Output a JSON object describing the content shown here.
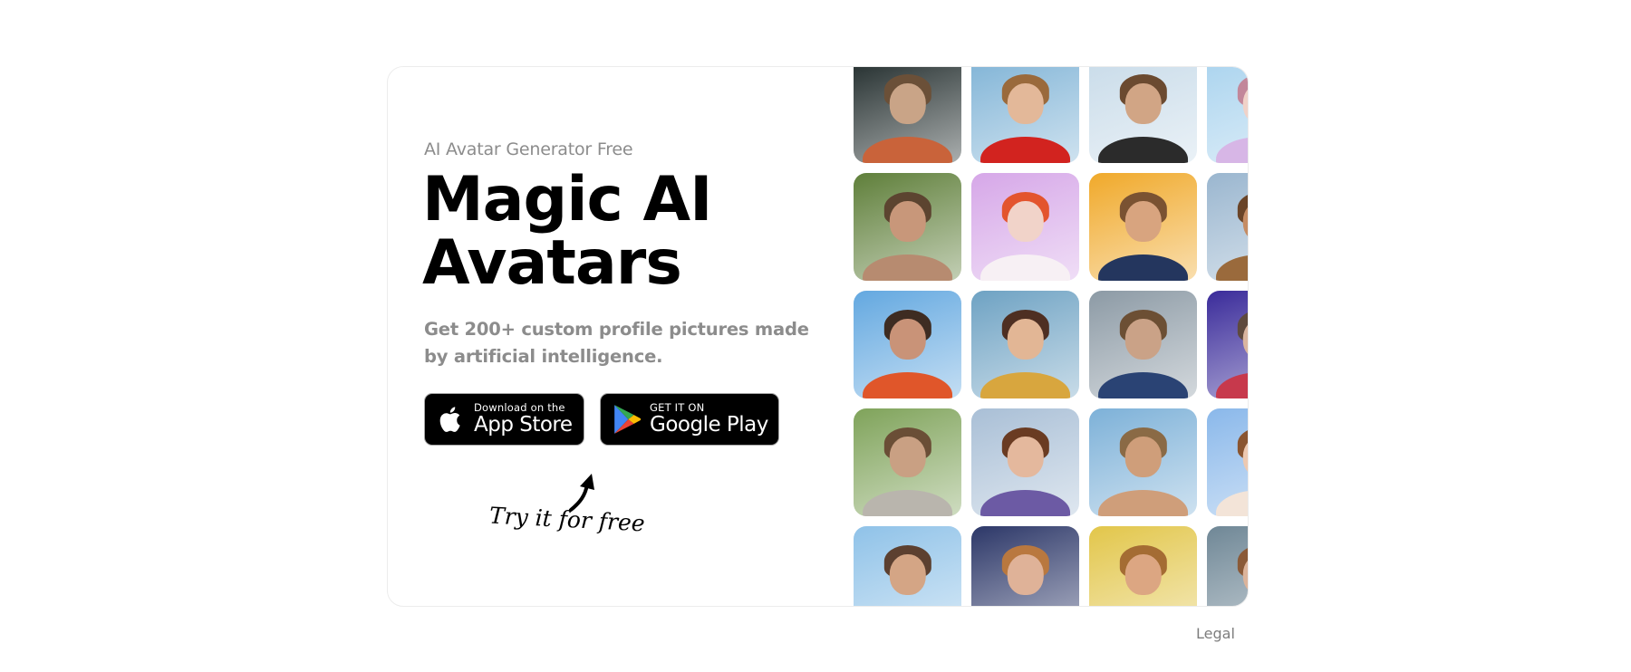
{
  "hero": {
    "subtitle": "AI Avatar Generator Free",
    "title_line1": "Magic AI",
    "title_line2": "Avatars",
    "description": "Get 200+ custom profile pictures made by artificial intelligence."
  },
  "buttons": {
    "app_store": {
      "small": "Download on the",
      "big": "App Store",
      "icon": "apple-icon"
    },
    "google_play": {
      "small": "GET IT ON",
      "big": "Google Play",
      "icon": "google-play-icon"
    }
  },
  "callout": {
    "text": "Try it for free",
    "icon": "curved-arrow-icon"
  },
  "footer": {
    "legal": "Legal"
  },
  "colors": {
    "text_muted": "#8c8c8c",
    "button_bg": "#000000",
    "card_border": "#ececec"
  },
  "avatars": [
    {
      "bg": "#1f2a2a",
      "skin": "#c9a487",
      "hair": "#6b5038",
      "cloth": "#c9633a"
    },
    {
      "bg": "#7fb3d6",
      "skin": "#e3b899",
      "hair": "#9a6a3c",
      "cloth": "#d2231f"
    },
    {
      "bg": "#c8dbe9",
      "skin": "#d1a585",
      "hair": "#6b4a30",
      "cloth": "#2b2b2b"
    },
    {
      "bg": "#a9d3ee",
      "skin": "#f0d2c8",
      "hair": "#c2879a",
      "cloth": "#d7b6e6"
    },
    {
      "bg": "#5f7f3a",
      "skin": "#c8977a",
      "hair": "#5c4430",
      "cloth": "#b78b70"
    },
    {
      "bg": "#d6a7e8",
      "skin": "#f1d3c9",
      "hair": "#e3542e",
      "cloth": "#f7f0f4"
    },
    {
      "bg": "#f0a92a",
      "skin": "#d8a47f",
      "hair": "#7a5232",
      "cloth": "#24365e"
    },
    {
      "bg": "#9ab6cf",
      "skin": "#c58c64",
      "hair": "#6a4428",
      "cloth": "#9a6a3c"
    },
    {
      "bg": "#63a8e0",
      "skin": "#c99378",
      "hair": "#3e2c22",
      "cloth": "#e0562a"
    },
    {
      "bg": "#6ea2c3",
      "skin": "#e2b695",
      "hair": "#4e2f22",
      "cloth": "#d8a63e"
    },
    {
      "bg": "#8c9aa5",
      "skin": "#caa287",
      "hair": "#6c4f34",
      "cloth": "#2a4374"
    },
    {
      "bg": "#3a2b9a",
      "skin": "#d9b5a0",
      "hair": "#5e4a3e",
      "cloth": "#c7394c"
    },
    {
      "bg": "#7fa35a",
      "skin": "#c9a083",
      "hair": "#6a4e36",
      "cloth": "#b9b5ad"
    },
    {
      "bg": "#a9bfd6",
      "skin": "#e4b89d",
      "hair": "#6a3b22",
      "cloth": "#6c5aa4"
    },
    {
      "bg": "#7db1d8",
      "skin": "#cf9e7a",
      "hair": "#8a6a45",
      "cloth": "#cf9e7a"
    },
    {
      "bg": "#8ab8ea",
      "skin": "#edc9b1",
      "hair": "#8a5530",
      "cloth": "#f3e4d8"
    },
    {
      "bg": "#8fc2e8",
      "skin": "#d4a585",
      "hair": "#5c4030",
      "cloth": "#7fb0b0"
    },
    {
      "bg": "#2c3768",
      "skin": "#dfb298",
      "hair": "#b9783f",
      "cloth": "#8a2a3a"
    },
    {
      "bg": "#e2c64a",
      "skin": "#dca682",
      "hair": "#a46c33",
      "cloth": "#6a2d24"
    },
    {
      "bg": "#6f8796",
      "skin": "#dcb49b",
      "hair": "#8a5a38",
      "cloth": "#3b3f46"
    }
  ]
}
